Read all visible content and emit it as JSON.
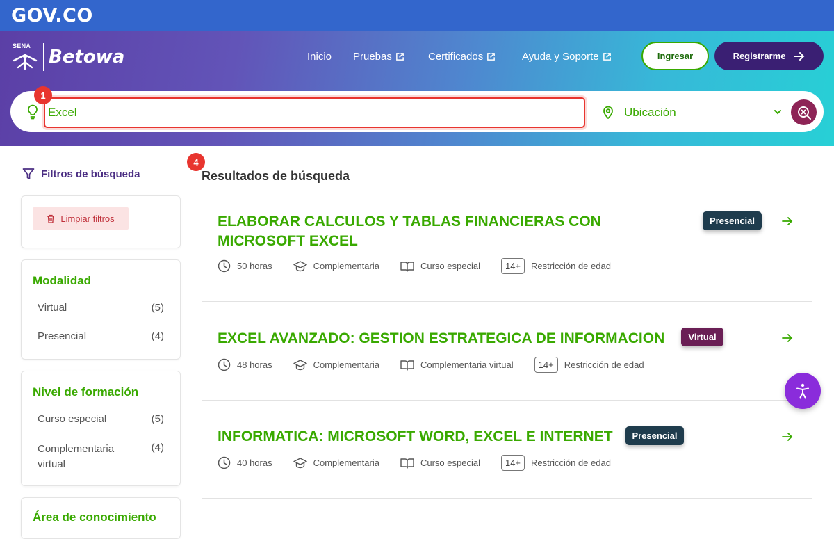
{
  "govbar": {
    "logo": "GOV.CO"
  },
  "header": {
    "sena_text": "SENA",
    "brand": "Betowa",
    "nav": [
      {
        "label": "Inicio",
        "external": false
      },
      {
        "label": "Pruebas",
        "external": true
      },
      {
        "label": "Certificados",
        "external": true
      },
      {
        "label": "Ayuda y Soporte",
        "external": true
      }
    ],
    "login_label": "Ingresar",
    "register_label": "Registrarme"
  },
  "search": {
    "value": "Excel",
    "location_placeholder": "Ubicación",
    "marker_1": "1",
    "marker_4": "4"
  },
  "sidebar": {
    "title": "Filtros de búsqueda",
    "clear_label": "Limpiar filtros",
    "groups": [
      {
        "title": "Modalidad",
        "options": [
          {
            "label": "Virtual",
            "count": "(5)"
          },
          {
            "label": "Presencial",
            "count": "(4)"
          }
        ]
      },
      {
        "title": "Nivel de formación",
        "options": [
          {
            "label": "Curso especial",
            "count": "(5)"
          },
          {
            "label": "Complementaria virtual",
            "count": "(4)"
          }
        ]
      },
      {
        "title": "Área de conocimiento"
      }
    ]
  },
  "results": {
    "title": "Resultados de búsqueda",
    "items": [
      {
        "title": "ELABORAR CALCULOS Y TABLAS FINANCIERAS CON MICROSOFT EXCEL",
        "modality": "Presencial",
        "hours": "50 horas",
        "type": "Complementaria",
        "program": "Curso especial",
        "age": "14+",
        "age_label": "Restricción de edad"
      },
      {
        "title": "EXCEL AVANZADO: GESTION ESTRATEGICA DE INFORMACION",
        "modality": "Virtual",
        "hours": "48 horas",
        "type": "Complementaria",
        "program": "Complementaria virtual",
        "age": "14+",
        "age_label": "Restricción de edad"
      },
      {
        "title": "INFORMATICA: MICROSOFT WORD, EXCEL E INTERNET",
        "modality": "Presencial",
        "hours": "40 horas",
        "type": "Complementaria",
        "program": "Curso especial",
        "age": "14+",
        "age_label": "Restricción de edad"
      }
    ]
  },
  "colors": {
    "gov_blue": "#3366cc",
    "green": "#39a900",
    "purple": "#4b2e83",
    "red_marker": "#e8352f",
    "virtual_badge": "#6a1f55",
    "presencial_badge": "#1f3c4d"
  }
}
